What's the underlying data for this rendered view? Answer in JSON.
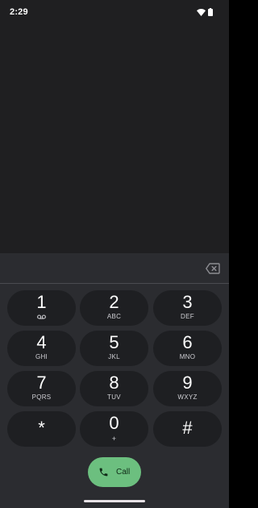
{
  "status_bar": {
    "time": "2:29"
  },
  "dialer": {
    "digits": "",
    "keys": [
      {
        "digit": "1",
        "letters": "",
        "extra": "voicemail-icon"
      },
      {
        "digit": "2",
        "letters": "ABC"
      },
      {
        "digit": "3",
        "letters": "DEF"
      },
      {
        "digit": "4",
        "letters": "GHI"
      },
      {
        "digit": "5",
        "letters": "JKL"
      },
      {
        "digit": "6",
        "letters": "MNO"
      },
      {
        "digit": "7",
        "letters": "PQRS"
      },
      {
        "digit": "8",
        "letters": "TUV"
      },
      {
        "digit": "9",
        "letters": "WXYZ"
      },
      {
        "digit": "*",
        "letters": ""
      },
      {
        "digit": "0",
        "letters": "+"
      },
      {
        "digit": "#",
        "letters": ""
      }
    ],
    "call_label": "Call"
  },
  "colors": {
    "background": "#1f1f21",
    "panel": "#2b2c30",
    "key": "#1e1f22",
    "call_button": "#6cbf7f"
  }
}
